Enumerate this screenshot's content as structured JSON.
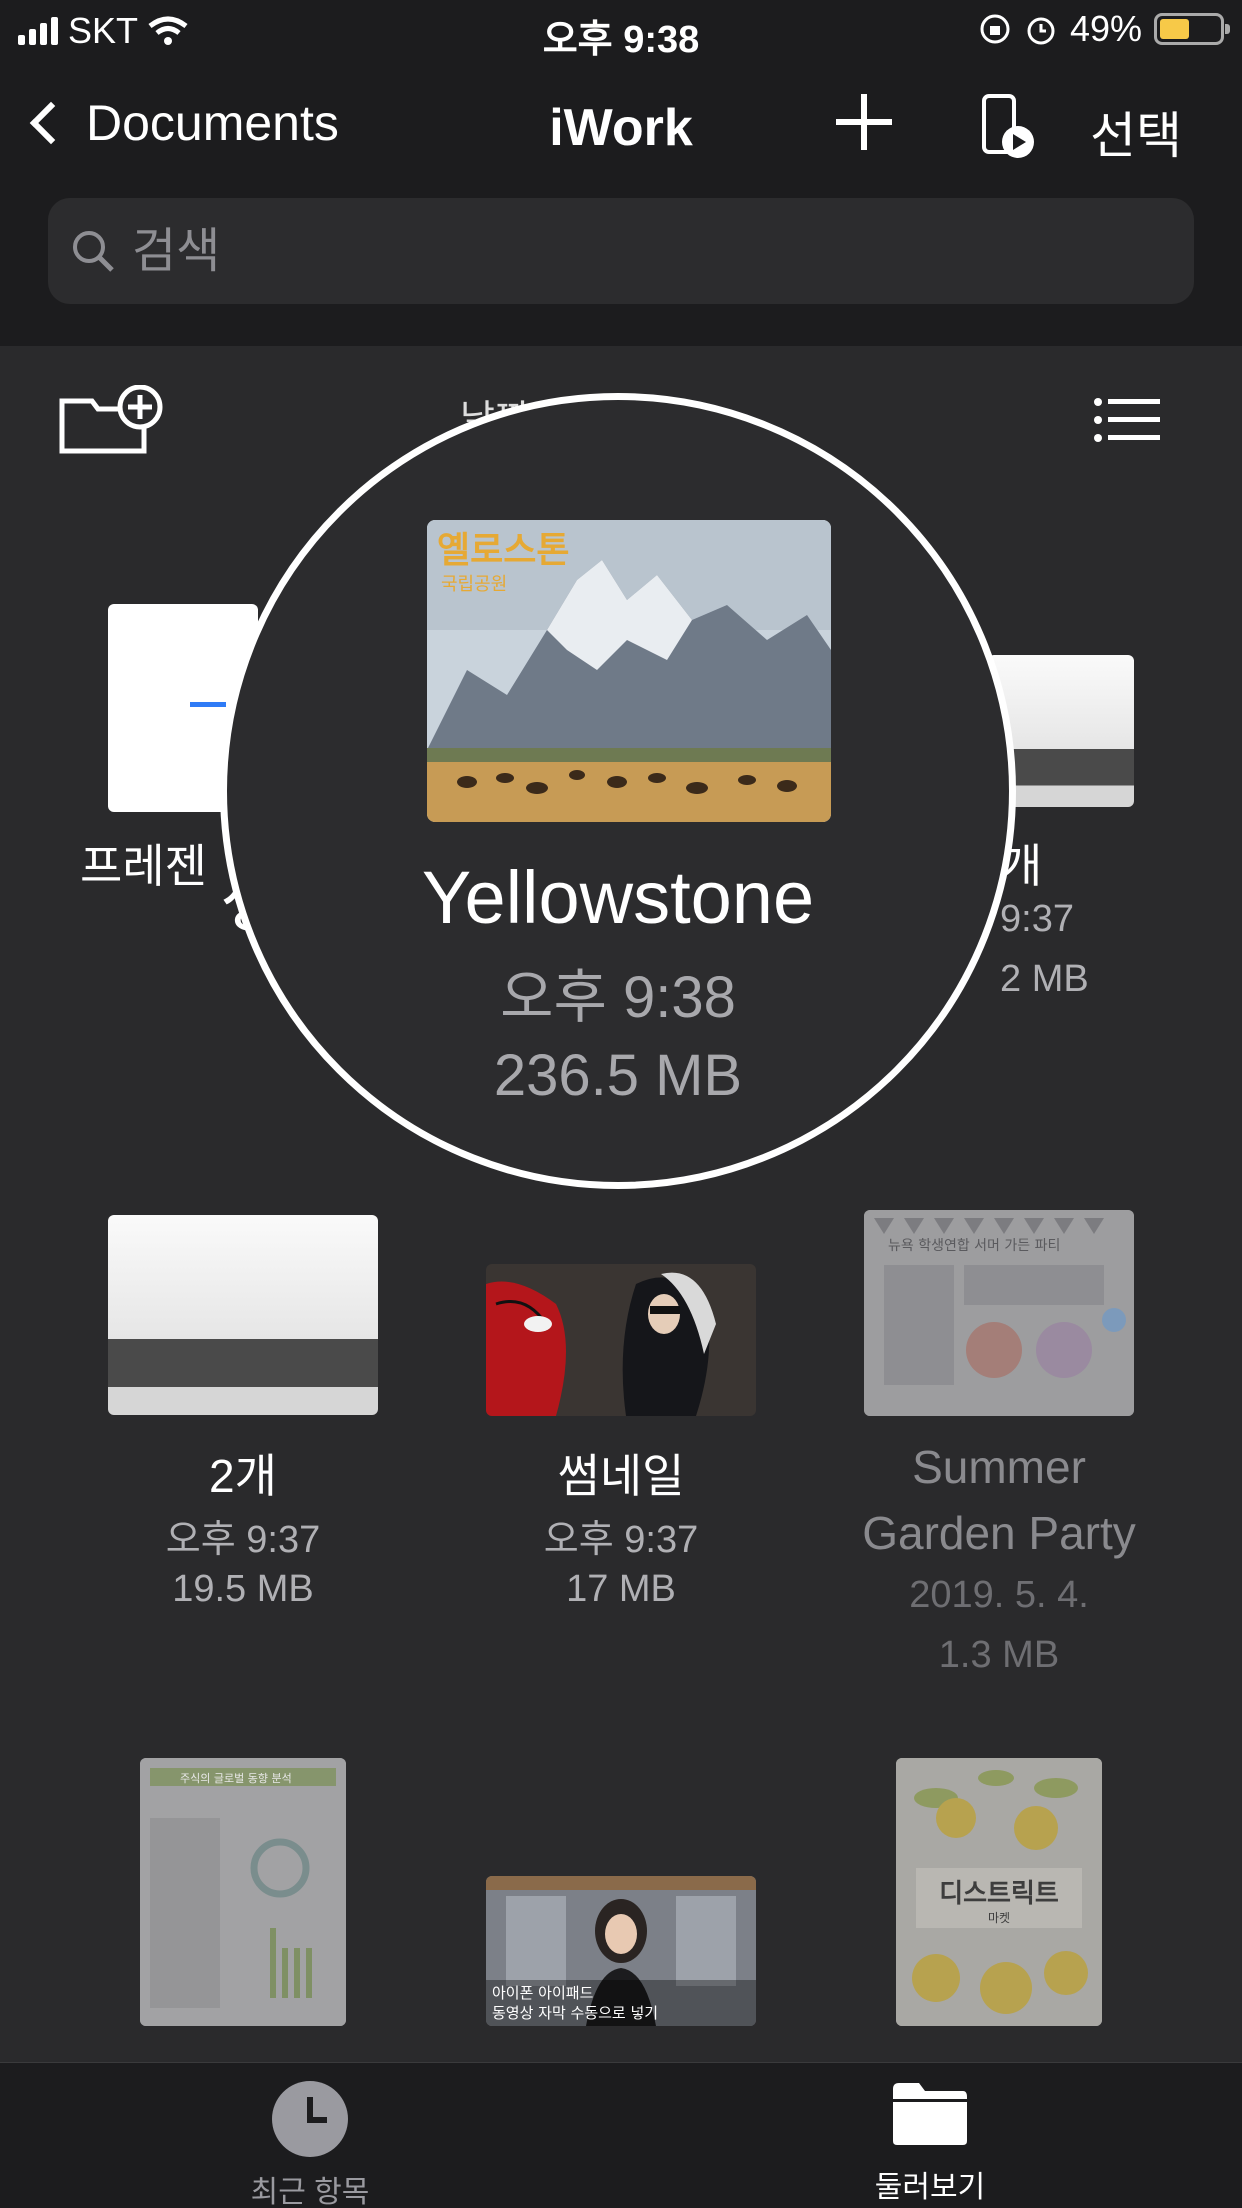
{
  "status_bar": {
    "carrier": "SKT",
    "time": "오후 9:38",
    "battery": "49%"
  },
  "nav": {
    "back_label": "Documents",
    "title": "iWork",
    "select_label": "선택"
  },
  "search": {
    "placeholder": "검색"
  },
  "toolbar": {
    "sort_label": "날짜 …      ▾"
  },
  "magnifier": {
    "name": "Yellowstone",
    "time": "오후 9:38",
    "size": "236.5 MB",
    "thumb_title": "옐로스톤",
    "thumb_subtitle": "국립공원"
  },
  "files_row1": {
    "left_name": "프레젠",
    "left_name_overlap": "생",
    "right_name": "개",
    "right_time": "9:37",
    "right_size": "2 MB"
  },
  "files_row2": [
    {
      "name": "2개",
      "time": "오후 9:37",
      "size": "19.5 MB"
    },
    {
      "name": "썸네일",
      "time": "오후 9:37",
      "size": "17 MB"
    },
    {
      "name_line1": "Summer",
      "name_line2": "Garden Party",
      "date": "2019. 5. 4.",
      "size": "1.3 MB",
      "thumb_title": "뉴욕 학생연합 서머 가든 파티"
    }
  ],
  "files_row3": [
    {
      "thumb_title": "주식의 글로벌 동향 분석"
    },
    {
      "thumb_caption_line1": "아이폰 아이패드",
      "thumb_caption_line2": "동영상 자막 수동으로 넣기"
    },
    {
      "thumb_title": "디스트릭트",
      "thumb_subtitle": "마켓"
    }
  ],
  "tabbar": {
    "recent_label": "최근 항목",
    "browse_label": "둘러보기"
  },
  "colors": {
    "background": "#2a2a2c",
    "bar": "#1c1c1e",
    "accent_blue": "#2f7bf6",
    "battery": "#f7c948"
  }
}
